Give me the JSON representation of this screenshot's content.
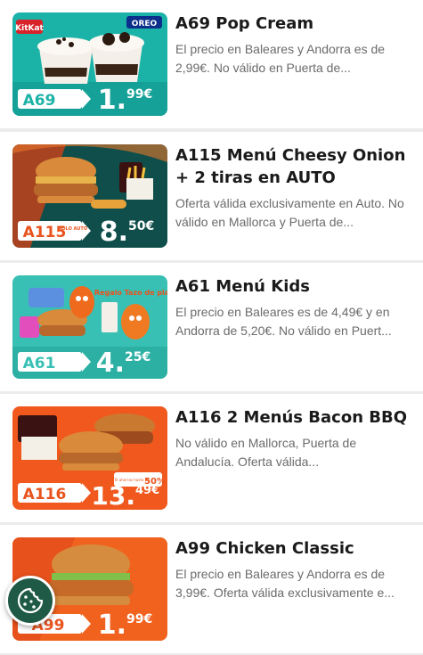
{
  "offers": [
    {
      "title": "A69 Pop Cream",
      "description": "El precio en Baleares y Andorra es de 2,99€. No válido en Puerta de...",
      "code": "A69",
      "price_main": "1.",
      "price_cents": "99€",
      "brand_left": "KitKat",
      "brand_right": "OREO",
      "bg_color": "#1bb3a8"
    },
    {
      "title": "A115 Menú Cheesy Onion + 2 tiras en AUTO",
      "description": "Oferta válida exclusivamente en Auto. No válido en Mallorca y Puerta de...",
      "code": "A115",
      "badge": "SOLO AUTO",
      "price_main": "8.",
      "price_cents": "50€",
      "bg_color": "#0f4e4a"
    },
    {
      "title": "A61 Menú Kids",
      "description": "El precio en Baleares es de 4,49€ y en Andorra de 5,20€. No válido en Puert...",
      "code": "A61",
      "price_main": "4.",
      "price_cents": "25€",
      "promo_text": "Regalo Tazo de plastilina",
      "bg_color": "#38c0b4"
    },
    {
      "title": "A116 2 Menús Bacon BBQ",
      "description": "No válido en Mallorca, Puerta de Andalucía. Oferta válida...",
      "code": "A116",
      "price_main": "13.",
      "price_cents": "49€",
      "discount_label": "Te ahorras hasta un",
      "discount_value": "50%",
      "bg_color": "#f0581e"
    },
    {
      "title": "A99 Chicken Classic",
      "description": "El precio en Baleares y Andorra es de 3,99€. Oferta válida exclusivamente e...",
      "code": "A99",
      "price_main": "1.",
      "price_cents": "99€",
      "bg_color": "#f0621e"
    }
  ],
  "cookie_button": {
    "icon": "cookie-icon",
    "color": "#1e5a45"
  },
  "colors": {
    "accent_teal": "#1bb3a8",
    "accent_orange": "#f0581e"
  }
}
